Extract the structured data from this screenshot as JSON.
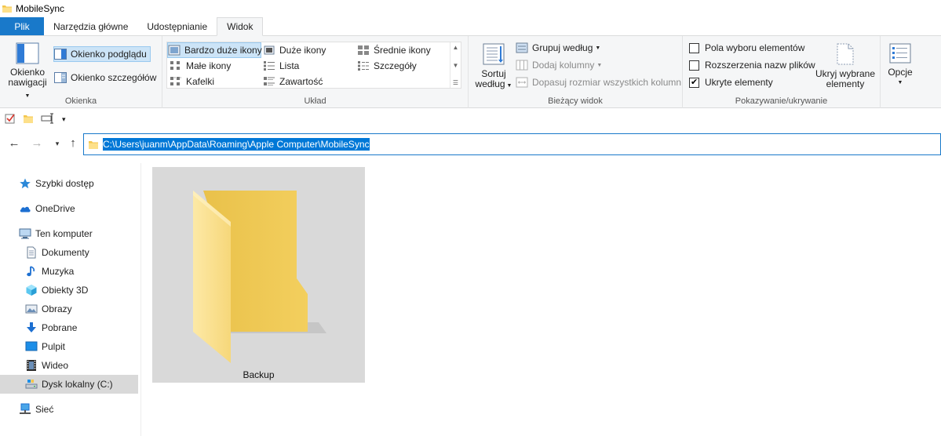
{
  "window": {
    "title": "MobileSync"
  },
  "tabs": [
    {
      "label": "Plik",
      "kind": "file"
    },
    {
      "label": "Narzędzia główne"
    },
    {
      "label": "Udostępnianie"
    },
    {
      "label": "Widok",
      "active": true
    }
  ],
  "ribbon": {
    "okienka": {
      "label": "Okienka",
      "nav_pane_line1": "Okienko",
      "nav_pane_line2": "nawigacji",
      "preview_pane": "Okienko podglądu",
      "details_pane": "Okienko szczegółów"
    },
    "uklad": {
      "label": "Układ",
      "items": [
        {
          "label": "Bardzo duże ikony",
          "selected": true
        },
        {
          "label": "Duże ikony"
        },
        {
          "label": "Średnie ikony"
        },
        {
          "label": "Małe ikony"
        },
        {
          "label": "Lista"
        },
        {
          "label": "Szczegóły"
        },
        {
          "label": "Kafelki"
        },
        {
          "label": "Zawartość"
        }
      ]
    },
    "biezacy": {
      "label": "Bieżący widok",
      "sort_line1": "Sortuj",
      "sort_line2": "według",
      "group_by": "Grupuj według",
      "add_columns": "Dodaj kolumny",
      "fit_columns": "Dopasuj rozmiar wszystkich kolumn"
    },
    "pokazywanie": {
      "label": "Pokazywanie/ukrywanie",
      "item_checkboxes": "Pola wyboru elementów",
      "file_extensions": "Rozszerzenia nazw plików",
      "hidden_items": "Ukryte elementy",
      "hide_selected_line1": "Ukryj wybrane",
      "hide_selected_line2": "elementy",
      "item_checkboxes_checked": false,
      "file_extensions_checked": false,
      "hidden_items_checked": true
    },
    "opcje": {
      "label": "Opcje"
    }
  },
  "address": {
    "path": "C:\\Users\\juanm\\AppData\\Roaming\\Apple Computer\\MobileSync"
  },
  "nav": {
    "quick_access": "Szybki dostęp",
    "onedrive": "OneDrive",
    "this_pc": "Ten komputer",
    "documents": "Dokumenty",
    "music": "Muzyka",
    "objects3d": "Obiekty 3D",
    "pictures": "Obrazy",
    "downloads": "Pobrane",
    "desktop": "Pulpit",
    "videos": "Wideo",
    "local_disk": "Dysk lokalny (C:)",
    "network": "Sieć"
  },
  "content": {
    "items": [
      {
        "name": "Backup",
        "type": "folder"
      }
    ]
  },
  "colors": {
    "accent": "#1979ca",
    "selection": "#0078d7",
    "folder_light": "#fde69d",
    "folder_dark": "#f1c74f"
  }
}
